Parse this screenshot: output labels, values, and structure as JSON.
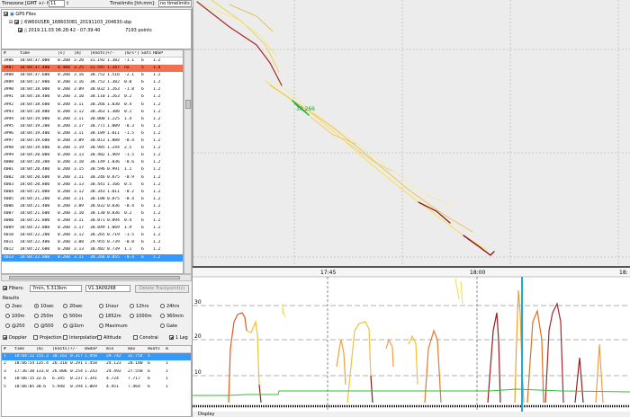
{
  "topbar": {
    "timezone_label": "Timezone [GMT +/- h]:",
    "timezone_value": "11",
    "timelimits_label": "Timelimits [hh:mm]:",
    "no_timelimits": "no timelimits"
  },
  "tree": {
    "root": "GPS Files",
    "file": "6W60USER_168603081_20191103_204630.sbp",
    "session_range": "2019.11.03 06:28:42 - 07:39:40",
    "points": "7193 points"
  },
  "table": {
    "headers": [
      "#",
      "time",
      "[s]",
      "[m]",
      "[knots]",
      "+/-",
      "[m/s²]",
      "Sats",
      "HDoP"
    ],
    "rows": [
      [
        "3986",
        "18:04:37.000",
        "0.200",
        "3.20",
        "31.192",
        "1.382",
        "-1.1",
        "6",
        "1.2"
      ],
      [
        "3987",
        "18:04:37.400",
        "0.400",
        "3.25",
        "31.597",
        "1.347",
        "na",
        "5",
        "1.4"
      ],
      [
        "3988",
        "18:04:37.600",
        "0.200",
        "3.16",
        "30.752",
        "1.516",
        "-2.1",
        "6",
        "1.2"
      ],
      [
        "3989",
        "18:04:17.800",
        "0.200",
        "3.16",
        "30.752",
        "1.382",
        "0.0",
        "6",
        "1.2"
      ],
      [
        "3990",
        "18:04:18.000",
        "0.200",
        "3.09",
        "30.032",
        "1.263",
        "-1.8",
        "6",
        "1.2"
      ],
      [
        "3991",
        "18:04:18.400",
        "0.200",
        "3.10",
        "30.110",
        "1.263",
        "0.2",
        "6",
        "1.2"
      ],
      [
        "3992",
        "18:04:18.600",
        "0.200",
        "3.11",
        "30.266",
        "1.030",
        "0.4",
        "6",
        "1.2"
      ],
      [
        "3993",
        "18:04:18.800",
        "0.200",
        "3.12",
        "30.363",
        "1.300",
        "0.2",
        "6",
        "1.2"
      ],
      [
        "3994",
        "18:04:19.000",
        "0.200",
        "3.11",
        "30.000",
        "1.225",
        "1.4",
        "6",
        "1.2"
      ],
      [
        "3995",
        "18:04:19.200",
        "0.200",
        "3.17",
        "30.771",
        "1.009",
        "-0.3",
        "6",
        "1.2"
      ],
      [
        "3996",
        "18:04:19.400",
        "0.200",
        "3.11",
        "30.189",
        "1.011",
        "-1.5",
        "6",
        "1.2"
      ],
      [
        "3997",
        "18:04:19.600",
        "0.200",
        "3.09",
        "30.013",
        "1.008",
        "-0.4",
        "6",
        "1.2"
      ],
      [
        "3998",
        "18:04:19.800",
        "0.200",
        "3.19",
        "30.985",
        "1.244",
        "2.5",
        "6",
        "1.2"
      ],
      [
        "3999",
        "18:04:20.000",
        "0.200",
        "3.13",
        "30.402",
        "1.469",
        "-1.5",
        "6",
        "1.2"
      ],
      [
        "4000",
        "18:04:20.200",
        "0.200",
        "3.10",
        "30.149",
        "1.836",
        "-0.6",
        "6",
        "1.2"
      ],
      [
        "4001",
        "18:04:20.400",
        "0.200",
        "3.15",
        "30.596",
        "0.991",
        "1.1",
        "6",
        "1.2"
      ],
      [
        "4002",
        "18:04:20.600",
        "0.200",
        "3.11",
        "30.246",
        "0.875",
        "-0.9",
        "6",
        "1.2"
      ],
      [
        "4003",
        "18:04:20.800",
        "0.200",
        "3.13",
        "30.441",
        "1.166",
        "0.5",
        "6",
        "1.2"
      ],
      [
        "4004",
        "18:04:21.000",
        "0.200",
        "3.12",
        "30.343",
        "1.011",
        "-0.2",
        "6",
        "1.2"
      ],
      [
        "4005",
        "18:04:21.200",
        "0.200",
        "3.11",
        "30.188",
        "0.875",
        "-0.4",
        "6",
        "1.2"
      ],
      [
        "4006",
        "18:04:21.400",
        "0.200",
        "3.09",
        "30.032",
        "0.836",
        "-0.4",
        "6",
        "1.2"
      ],
      [
        "4007",
        "18:04:21.600",
        "0.200",
        "3.10",
        "30.130",
        "0.836",
        "0.2",
        "6",
        "1.2"
      ],
      [
        "4008",
        "18:04:21.800",
        "0.200",
        "3.11",
        "30.071",
        "0.894",
        "0.4",
        "6",
        "1.2"
      ],
      [
        "4009",
        "18:04:22.000",
        "0.200",
        "3.17",
        "30.849",
        "1.069",
        "1.9",
        "6",
        "1.2"
      ],
      [
        "4010",
        "18:04:22.200",
        "0.200",
        "3.12",
        "30.265",
        "0.719",
        "-1.5",
        "6",
        "1.2"
      ],
      [
        "4011",
        "18:04:22.400",
        "0.200",
        "3.08",
        "29.955",
        "0.739",
        "-0.8",
        "6",
        "1.2"
      ],
      [
        "4012",
        "18:04:22.600",
        "0.200",
        "3.13",
        "30.402",
        "0.739",
        "1.1",
        "6",
        "1.2"
      ],
      [
        "4013",
        "18:04:22.800",
        "0.200",
        "3.11",
        "30.266",
        "0.855",
        "-0.4",
        "6",
        "1.2"
      ]
    ],
    "highlight_row": 1,
    "selected_row": 27
  },
  "filters": {
    "label": "Filters:",
    "value": "7min, 5.313km",
    "version": "V1.3A09268",
    "delete_button": "Delete Trackpoint(s)"
  },
  "results": {
    "label": "Results",
    "radios": [
      [
        "2sec",
        "10sec",
        "20sec",
        "1hour",
        "12hrs",
        "24hrs"
      ],
      [
        "100m",
        "250m",
        "500m",
        "1852m",
        "1000m",
        "360min"
      ],
      [
        "@250",
        "@500",
        "@1km",
        "Maximum",
        "",
        "Gate"
      ]
    ],
    "selected": "10sec",
    "checks": [
      "Doppler",
      "Projection",
      "Interpolation",
      "Altitude",
      "Constrai",
      "1 Leg"
    ],
    "checked": [
      "Doppler",
      "1 Leg"
    ]
  },
  "results_table": {
    "headers": [
      "#",
      "time",
      "[m]",
      "[knots]",
      "+/-",
      "mSDoP",
      "min",
      "max",
      "mSats",
      "m"
    ],
    "rows": [
      [
        "1",
        "18:04:12",
        "155.3",
        "30.162",
        "0.317",
        "1.458",
        "29.742",
        "32.754",
        "5",
        ""
      ],
      [
        "2",
        "18:06:54",
        "135.4",
        "26.310",
        "0.291",
        "1.458",
        "24.123",
        "28.180",
        "6",
        "1"
      ],
      [
        "3",
        "17:36:38",
        "133.8",
        "26.006",
        "0.254",
        "1.243",
        "24.492",
        "27.558",
        "6",
        "1"
      ],
      [
        "4",
        "18:06:15",
        "32.6",
        "6.345",
        "0.237",
        "1.341",
        "4.724",
        "7.717",
        "6",
        "1"
      ],
      [
        "5",
        "18:06:05",
        "30.6",
        "5.948",
        "0.194",
        "1.069",
        "4.451",
        "7.464",
        "6",
        "1"
      ]
    ],
    "selected_row": 0
  },
  "map": {
    "speed_label": "30.266"
  },
  "graph": {
    "time_labels": [
      "17:45",
      "18:00",
      "18:"
    ],
    "y_labels": [
      "30",
      "20",
      "10"
    ],
    "status_label": "Display"
  },
  "colors": {
    "highlight": "#f07050",
    "selected": "#3399ff",
    "cursor": "#22aacc",
    "green": "#2fbf2f"
  }
}
